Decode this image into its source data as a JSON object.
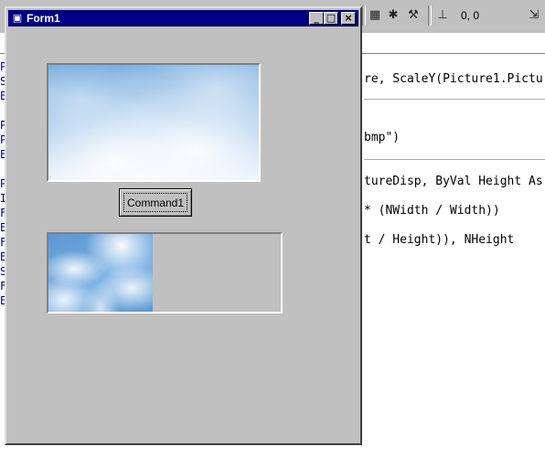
{
  "ide": {
    "toolbar": {
      "coords": "0, 0",
      "icons": [
        "grid-icon",
        "toolbox-icon",
        "tools-icon",
        "position-icon",
        "size-icon"
      ]
    },
    "code": {
      "lines": [
        {
          "text": "re, ScaleY(Picture1.Pictu"
        },
        {
          "text": "bmp\")"
        },
        {
          "text": "tureDisp, ByVal Height As"
        },
        {
          "text": "* (NWidth / Width))"
        },
        {
          "text": "t / Height)), NHeight"
        }
      ],
      "gutter": [
        "P",
        "S",
        "E",
        "P",
        "P",
        "E",
        "P",
        "I",
        "F",
        "E",
        "F",
        "E",
        "S",
        "F",
        "E"
      ]
    }
  },
  "form": {
    "title": "Form1",
    "title_icon": "form-icon",
    "caption_buttons": {
      "minimize": "_",
      "maximize": "□",
      "close": "×"
    },
    "command_button_label": "Command1"
  }
}
